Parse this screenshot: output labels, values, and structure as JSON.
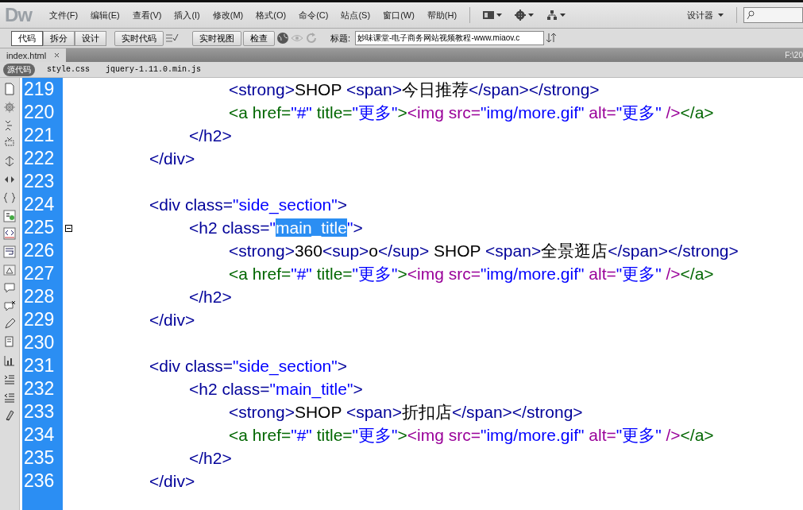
{
  "menu_bar": {
    "logo": "Dw",
    "items": [
      "文件(F)",
      "编辑(E)",
      "查看(V)",
      "插入(I)",
      "修改(M)",
      "格式(O)",
      "命令(C)",
      "站点(S)",
      "窗口(W)",
      "帮助(H)"
    ],
    "workspace": "设计器"
  },
  "toolbar": {
    "view_buttons": [
      {
        "label": "代码",
        "selected": true
      },
      {
        "label": "拆分",
        "selected": false
      },
      {
        "label": "设计",
        "selected": false
      }
    ],
    "live_code": "实时代码",
    "live_view": "实时视图",
    "inspect": "检查",
    "title_label": "标题:",
    "title_value": "妙味课堂-电子商务网站视频教程-www.miaov.c"
  },
  "document_tabs": [
    {
      "label": "index.html",
      "selected": true
    }
  ],
  "path": "F:\\20",
  "related_files": [
    {
      "label": "源代码",
      "selected": true
    },
    {
      "label": "style.css",
      "selected": false
    },
    {
      "label": "jquery-1.11.0.min.js",
      "selected": false
    }
  ],
  "editor": {
    "lines": [
      {
        "children": [
          {
            "children": [
              {
                "number": "219",
                "tokens": [
                  {
                    "kind": "tag",
                    "text": "<strong>"
                  },
                  {
                    "kind": "text",
                    "text": "SHOP "
                  },
                  {
                    "kind": "tag",
                    "text": "<span>"
                  },
                  {
                    "kind": "text",
                    "text": "今日推荐"
                  },
                  {
                    "kind": "tag",
                    "text": "</span></strong>"
                  }
                ]
              },
              {
                "number": "220",
                "tokens": [
                  {
                    "kind": "link",
                    "text": "<a href="
                  },
                  {
                    "kind": "value",
                    "text": "\"#\""
                  },
                  {
                    "kind": "link",
                    "text": " title="
                  },
                  {
                    "kind": "value",
                    "text": "\"更多\""
                  },
                  {
                    "kind": "link",
                    "text": ">"
                  },
                  {
                    "kind": "image",
                    "text": "<img src="
                  },
                  {
                    "kind": "value",
                    "text": "\"img/more.gif\""
                  },
                  {
                    "kind": "image",
                    "text": " alt="
                  },
                  {
                    "kind": "value",
                    "text": "\"更多\""
                  },
                  {
                    "kind": "image",
                    "text": " />"
                  },
                  {
                    "kind": "link",
                    "text": "</a>"
                  }
                ]
              }
            ]
          },
          {
            "number": "221",
            "tokens": [
              {
                "kind": "tag",
                "text": "</h2>"
              }
            ]
          }
        ]
      },
      {
        "number": "222",
        "tokens": [
          {
            "kind": "tag",
            "text": "</div>"
          }
        ]
      },
      {
        "number": "223"
      },
      {
        "number": "224",
        "tokens": [
          {
            "kind": "tag",
            "text": "<div class="
          },
          {
            "kind": "value",
            "text": "\"side_section\""
          },
          {
            "kind": "tag",
            "text": ">"
          }
        ],
        "children": [
          {
            "number": "225",
            "folded": false,
            "tokens": [
              {
                "kind": "tag",
                "text": "<h2 class="
              },
              {
                "kind": "value",
                "text": "\""
              },
              {
                "kind": "value",
                "text": "main_title",
                "selected": true
              },
              {
                "kind": "value",
                "text": "\""
              },
              {
                "kind": "tag",
                "text": ">"
              }
            ],
            "children": [
              {
                "number": "226",
                "tokens": [
                  {
                    "kind": "tag",
                    "text": "<strong>"
                  },
                  {
                    "kind": "text",
                    "text": "360"
                  },
                  {
                    "kind": "tag",
                    "text": "<sup>"
                  },
                  {
                    "kind": "text",
                    "text": "o"
                  },
                  {
                    "kind": "tag",
                    "text": "</sup>"
                  },
                  {
                    "kind": "text",
                    "text": " SHOP "
                  },
                  {
                    "kind": "tag",
                    "text": "<span>"
                  },
                  {
                    "kind": "text",
                    "text": "全景逛店"
                  },
                  {
                    "kind": "tag",
                    "text": "</span></strong>"
                  }
                ]
              },
              {
                "number": "227",
                "tokens": [
                  {
                    "kind": "link",
                    "text": "<a href="
                  },
                  {
                    "kind": "value",
                    "text": "\"#\""
                  },
                  {
                    "kind": "link",
                    "text": " title="
                  },
                  {
                    "kind": "value",
                    "text": "\"更多\""
                  },
                  {
                    "kind": "link",
                    "text": ">"
                  },
                  {
                    "kind": "image",
                    "text": "<img src="
                  },
                  {
                    "kind": "value",
                    "text": "\"img/more.gif\""
                  },
                  {
                    "kind": "image",
                    "text": " alt="
                  },
                  {
                    "kind": "value",
                    "text": "\"更多\""
                  },
                  {
                    "kind": "image",
                    "text": " />"
                  },
                  {
                    "kind": "link",
                    "text": "</a>"
                  }
                ]
              }
            ]
          },
          {
            "number": "228",
            "tokens": [
              {
                "kind": "tag",
                "text": "</h2>"
              }
            ]
          }
        ]
      },
      {
        "number": "229",
        "tokens": [
          {
            "kind": "tag",
            "text": "</div>"
          }
        ]
      },
      {
        "number": "230"
      },
      {
        "number": "231",
        "tokens": [
          {
            "kind": "tag",
            "text": "<div class="
          },
          {
            "kind": "value",
            "text": "\"side_section\""
          },
          {
            "kind": "tag",
            "text": ">"
          }
        ],
        "children": [
          {
            "number": "232",
            "tokens": [
              {
                "kind": "tag",
                "text": "<h2 class="
              },
              {
                "kind": "value",
                "text": "\"main_title\""
              },
              {
                "kind": "tag",
                "text": ">"
              }
            ],
            "children": [
              {
                "number": "233",
                "tokens": [
                  {
                    "kind": "tag",
                    "text": "<strong>"
                  },
                  {
                    "kind": "text",
                    "text": "SHOP "
                  },
                  {
                    "kind": "tag",
                    "text": "<span>"
                  },
                  {
                    "kind": "text",
                    "text": "折扣店"
                  },
                  {
                    "kind": "tag",
                    "text": "</span></strong>"
                  }
                ]
              },
              {
                "number": "234",
                "tokens": [
                  {
                    "kind": "link",
                    "text": "<a href="
                  },
                  {
                    "kind": "value",
                    "text": "\"#\""
                  },
                  {
                    "kind": "link",
                    "text": " title="
                  },
                  {
                    "kind": "value",
                    "text": "\"更多\""
                  },
                  {
                    "kind": "link",
                    "text": ">"
                  },
                  {
                    "kind": "image",
                    "text": "<img src="
                  },
                  {
                    "kind": "value",
                    "text": "\"img/more.gif\""
                  },
                  {
                    "kind": "image",
                    "text": " alt="
                  },
                  {
                    "kind": "value",
                    "text": "\"更多\""
                  },
                  {
                    "kind": "image",
                    "text": " />"
                  },
                  {
                    "kind": "link",
                    "text": "</a>"
                  }
                ]
              }
            ]
          },
          {
            "number": "235",
            "tokens": [
              {
                "kind": "tag",
                "text": "</h2>"
              }
            ]
          }
        ]
      },
      {
        "number": "236",
        "tokens": [
          {
            "kind": "tag",
            "text": "</div>"
          }
        ]
      }
    ]
  }
}
